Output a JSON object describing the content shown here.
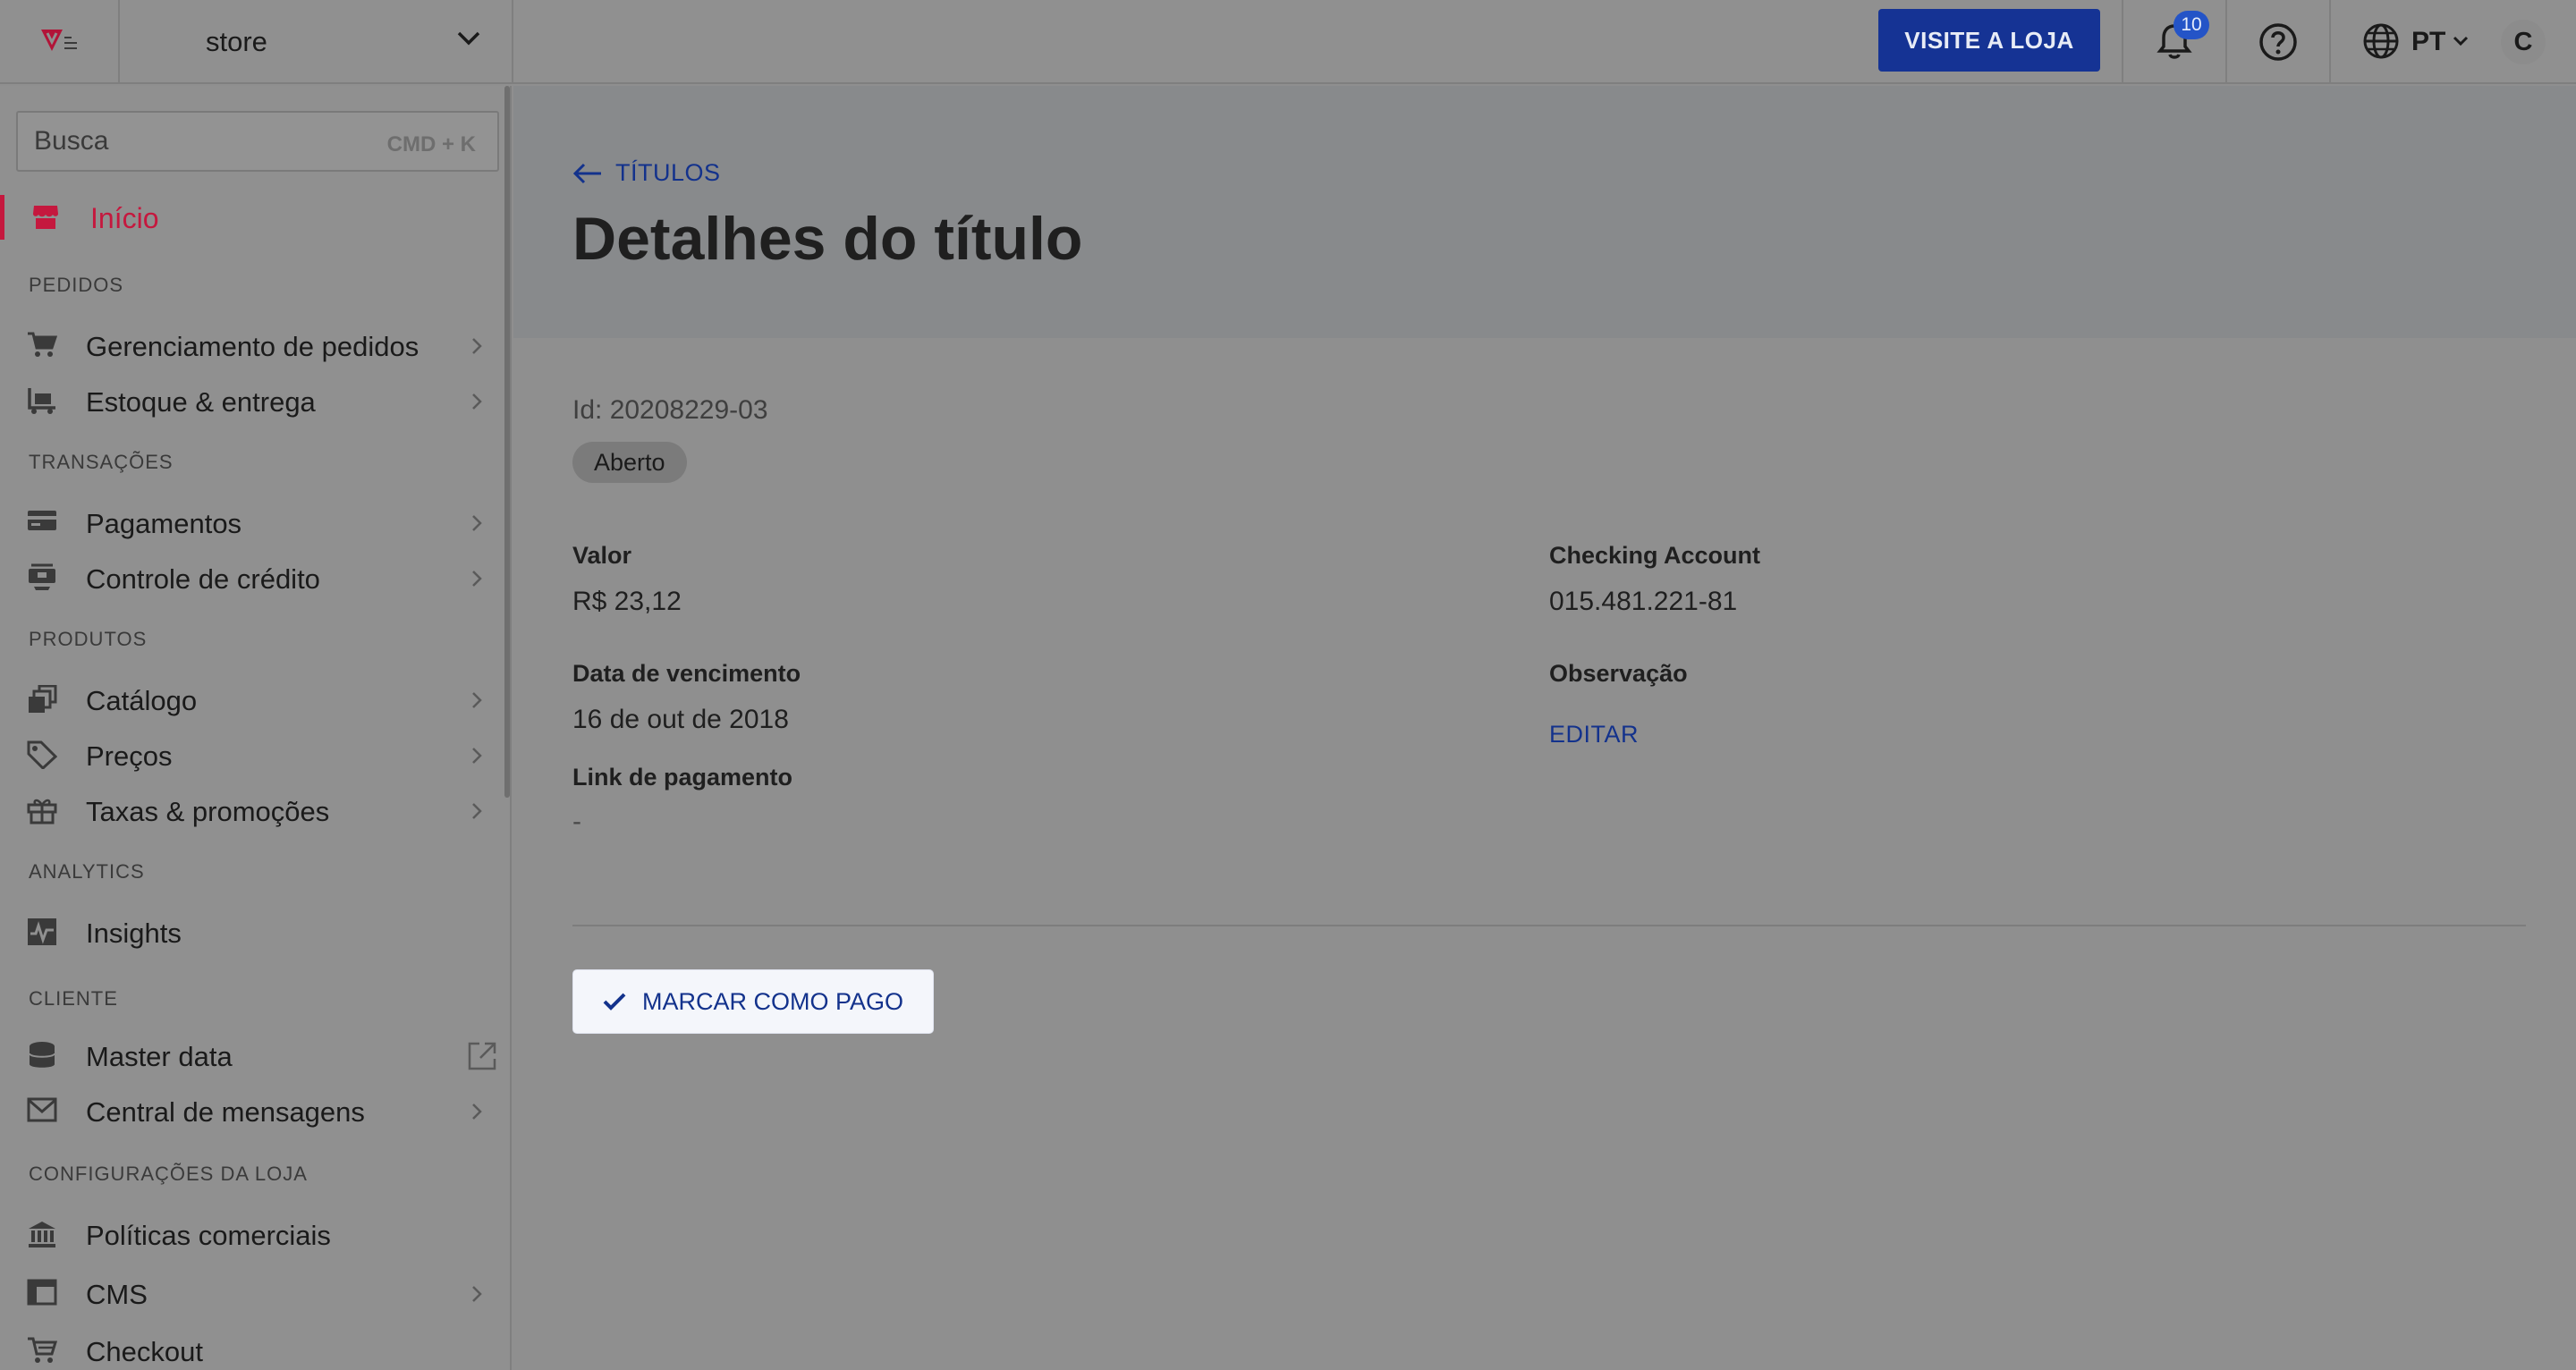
{
  "topbar": {
    "store_name": "store",
    "visit_label": "VISITE A LOJA",
    "notifications_count": "10",
    "language": "PT",
    "avatar_initial": "C"
  },
  "sidebar": {
    "search_placeholder": "Busca",
    "search_shortcut": "CMD + K",
    "home_label": "Início",
    "sections": {
      "pedidos": "PEDIDOS",
      "transacoes": "TRANSAÇÕES",
      "produtos": "PRODUTOS",
      "analytics": "ANALYTICS",
      "cliente": "CLIENTE",
      "config": "CONFIGURAÇÕES DA LOJA"
    },
    "items": {
      "orders": "Gerenciamento de pedidos",
      "inventory": "Estoque & entrega",
      "payments": "Pagamentos",
      "credit": "Controle de crédito",
      "catalog": "Catálogo",
      "prices": "Preços",
      "promotions": "Taxas & promoções",
      "insights": "Insights",
      "masterdata": "Master data",
      "messages": "Central de mensagens",
      "policies": "Políticas comerciais",
      "cms": "CMS",
      "checkout": "Checkout"
    }
  },
  "main": {
    "back_label": "TÍTULOS",
    "title": "Detalhes do título",
    "id_text": "Id: 20208229-03",
    "status": "Aberto",
    "fields": {
      "valor_label": "Valor",
      "valor": "R$ 23,12",
      "vencimento_label": "Data de vencimento",
      "vencimento": "16 de out de 2018",
      "link_label": "Link de pagamento",
      "link": "-",
      "account_label": "Checking Account",
      "account": "015.481.221-81",
      "obs_label": "Observação",
      "edit_label": "EDITAR"
    },
    "mark_paid_label": "MARCAR COMO PAGO"
  }
}
